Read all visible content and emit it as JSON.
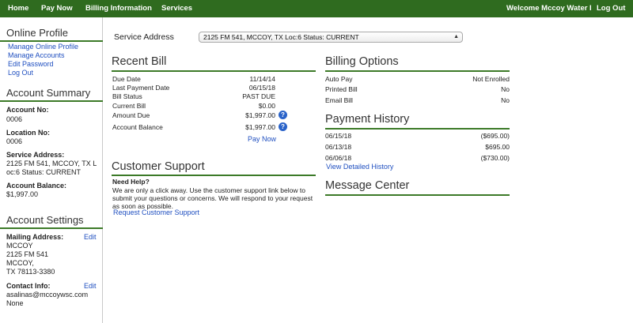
{
  "nav": {
    "home": "Home",
    "pay_now": "Pay Now",
    "billing_info": "Billing Information",
    "services": "Services",
    "welcome": "Welcome Mccoy Water I",
    "logout": "Log Out"
  },
  "sidebar": {
    "online_profile": {
      "title": "Online Profile",
      "links": [
        "Manage Online Profile",
        "Manage Accounts",
        "Edit Password",
        "Log Out"
      ]
    },
    "account_summary": {
      "title": "Account Summary",
      "account_no_label": "Account No:",
      "account_no": "0006",
      "location_no_label": "Location No:",
      "location_no": "0006",
      "service_address_label": "Service Address:",
      "service_address_line1": "2125 FM 541, MCCOY, TX L",
      "service_address_line2": "oc:6 Status: CURRENT",
      "balance_label": "Account Balance:",
      "balance": "$1,997.00"
    },
    "account_settings": {
      "title": "Account Settings",
      "mailing_label": "Mailing Address:",
      "mailing_edit": "Edit",
      "mailing_lines": [
        "MCCOY",
        "2125 FM 541",
        "MCCOY,",
        "TX 78113-3380"
      ],
      "contact_label": "Contact Info:",
      "contact_edit": "Edit",
      "contact_lines": [
        "asalinas@mccoywsc.com",
        "None"
      ]
    }
  },
  "service_address": {
    "label": "Service Address",
    "selected": "2125 FM 541, MCCOY, TX Loc:6 Status: CURRENT"
  },
  "recent_bill": {
    "title": "Recent Bill",
    "rows": [
      {
        "label": "Due Date",
        "value": "11/14/14"
      },
      {
        "label": "Last Payment Date",
        "value": "06/15/18"
      },
      {
        "label": "Bill Status",
        "value": "PAST DUE"
      },
      {
        "label": "Current Bill",
        "value": "$0.00"
      },
      {
        "label": "Amount Due",
        "value": "$1,997.00"
      },
      {
        "label": "Account Balance",
        "value": "$1,997.00"
      }
    ],
    "pay_now": "Pay Now"
  },
  "billing_options": {
    "title": "Billing Options",
    "rows": [
      {
        "label": "Auto Pay",
        "value": "Not Enrolled"
      },
      {
        "label": "Printed Bill",
        "value": "No"
      },
      {
        "label": "Email Bill",
        "value": "No"
      }
    ]
  },
  "payment_history": {
    "title": "Payment History",
    "rows": [
      {
        "date": "06/15/18",
        "amount": "($695.00)"
      },
      {
        "date": "06/13/18",
        "amount": "$695.00"
      },
      {
        "date": "06/06/18",
        "amount": "($730.00)"
      }
    ],
    "detail_link": "View Detailed History"
  },
  "customer_support": {
    "title": "Customer Support",
    "need_help": "Need Help?",
    "text": "We are only a click away. Use the customer support link below to submit your questions or concerns. We will respond to your request as soon as possible.",
    "link": "Request Customer Support"
  },
  "message_center": {
    "title": "Message Center"
  },
  "colors": {
    "nav_green": "#2f6b1f",
    "rule_green": "#3c7a28",
    "link_blue": "#1f4fc0"
  }
}
